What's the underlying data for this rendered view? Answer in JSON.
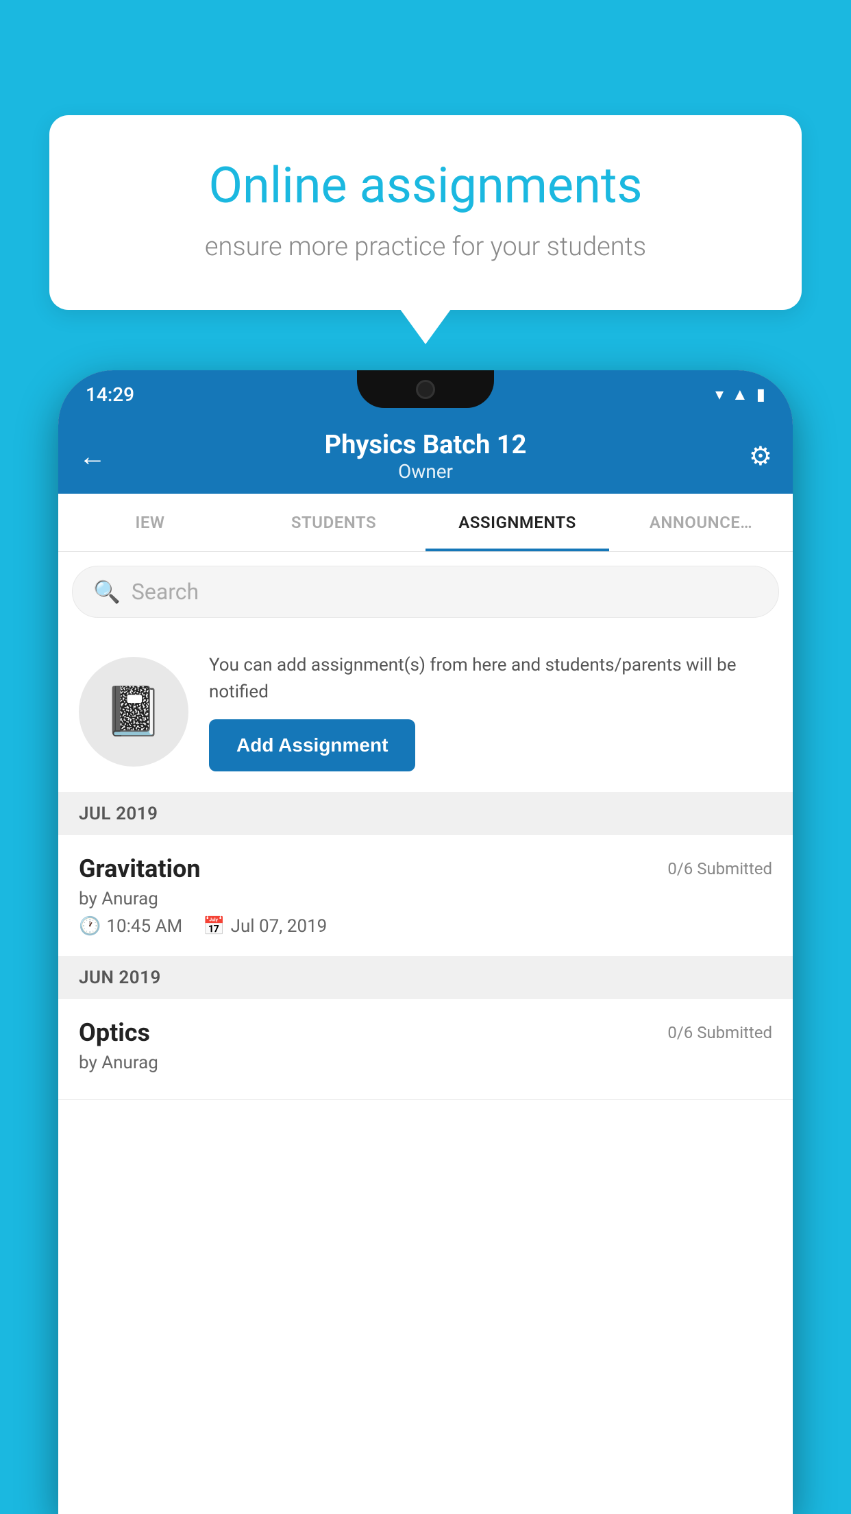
{
  "background_color": "#1bb8e0",
  "speech_bubble": {
    "title": "Online assignments",
    "subtitle": "ensure more practice for your students"
  },
  "status_bar": {
    "time": "14:29",
    "wifi": "▾",
    "signal": "▲",
    "battery": "▮"
  },
  "nav": {
    "title": "Physics Batch 12",
    "subtitle": "Owner",
    "back_label": "←",
    "settings_label": "⚙"
  },
  "tabs": [
    {
      "label": "IEW",
      "active": false
    },
    {
      "label": "STUDENTS",
      "active": false
    },
    {
      "label": "ASSIGNMENTS",
      "active": true
    },
    {
      "label": "ANNOUNCE…",
      "active": false
    }
  ],
  "search": {
    "placeholder": "Search"
  },
  "add_assignment": {
    "description": "You can add assignment(s) from here and students/parents will be notified",
    "button_label": "Add Assignment",
    "icon": "📓"
  },
  "sections": [
    {
      "header": "JUL 2019",
      "assignments": [
        {
          "name": "Gravitation",
          "submitted": "0/6 Submitted",
          "by": "by Anurag",
          "time": "10:45 AM",
          "date": "Jul 07, 2019"
        }
      ]
    },
    {
      "header": "JUN 2019",
      "assignments": [
        {
          "name": "Optics",
          "submitted": "0/6 Submitted",
          "by": "by Anurag",
          "time": "",
          "date": ""
        }
      ]
    }
  ]
}
